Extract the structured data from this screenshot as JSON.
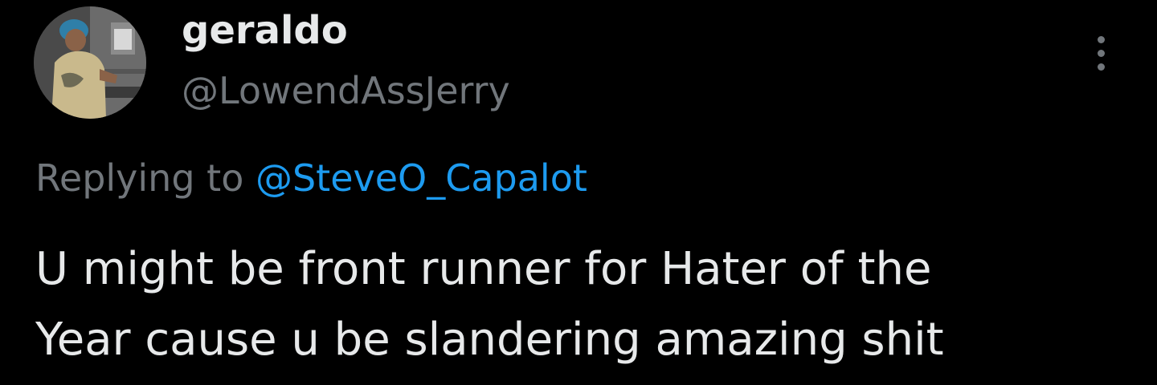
{
  "tweet": {
    "author": {
      "display_name": "geraldo",
      "handle": "@LowendAssJerry"
    },
    "reply": {
      "prefix": "Replying to ",
      "mention": "@SteveO_Capalot"
    },
    "text_lines": [
      "U might be front runner for Hater of the",
      "Year cause u be slandering amazing shit"
    ],
    "more_icon": "more-vertical-icon"
  },
  "colors": {
    "background": "#000000",
    "primary_text": "#e7e9ea",
    "secondary_text": "#71767b",
    "link": "#1d9bf0"
  }
}
